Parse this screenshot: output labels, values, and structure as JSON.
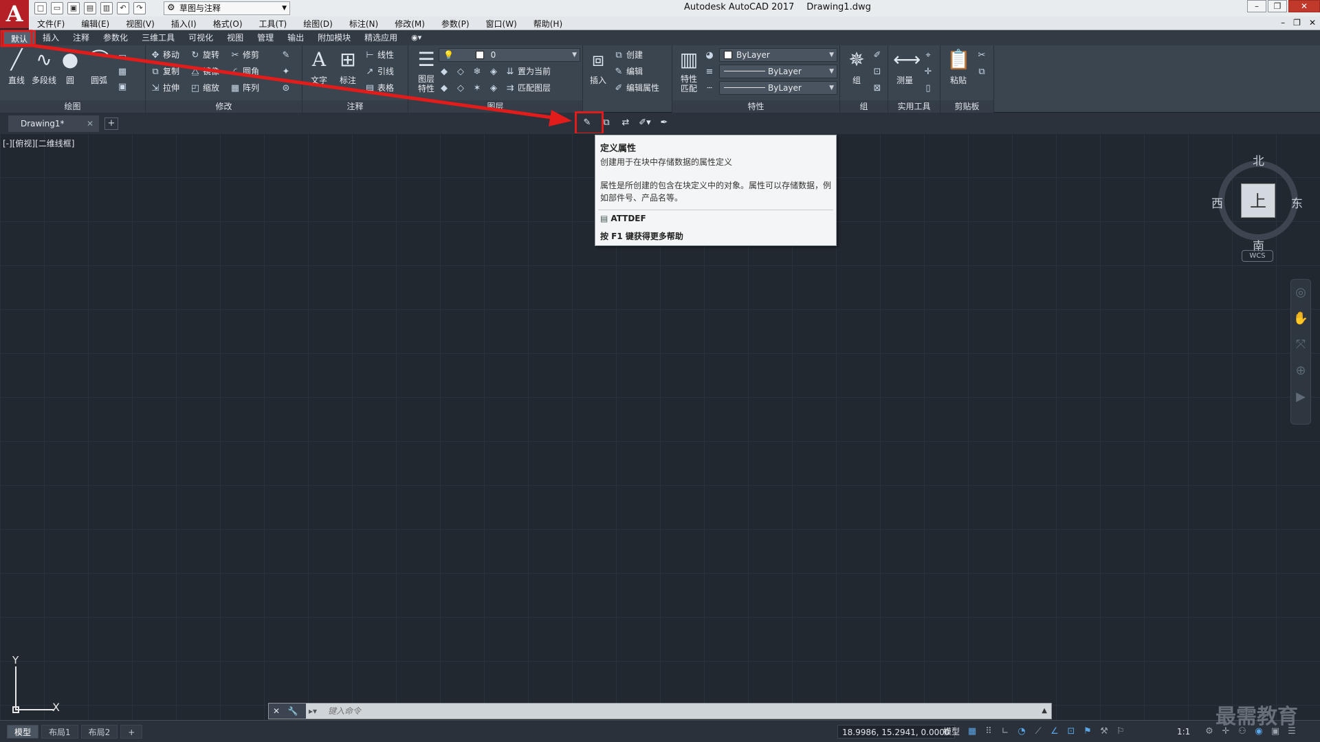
{
  "app": {
    "logo": "A",
    "title": "Autodesk AutoCAD 2017",
    "file": "Drawing1.dwg",
    "workspace": "草图与注释"
  },
  "menu": [
    "文件(F)",
    "编辑(E)",
    "视图(V)",
    "插入(I)",
    "格式(O)",
    "工具(T)",
    "绘图(D)",
    "标注(N)",
    "修改(M)",
    "参数(P)",
    "窗口(W)",
    "帮助(H)"
  ],
  "ribbon_tabs": [
    "默认",
    "插入",
    "注释",
    "参数化",
    "三维工具",
    "可视化",
    "视图",
    "管理",
    "输出",
    "附加模块",
    "精选应用"
  ],
  "ribbon": {
    "draw": {
      "title": "绘图",
      "line": "直线",
      "polyline": "多段线",
      "circle": "圆",
      "arc": "圆弧"
    },
    "modify": {
      "title": "修改",
      "move": "移动",
      "rotate": "旋转",
      "trim": "修剪",
      "copy": "复制",
      "mirror": "镜像",
      "fillet": "圆角",
      "stretch": "拉伸",
      "scale": "缩放",
      "array": "阵列"
    },
    "annotation": {
      "title": "注释",
      "text": "文字",
      "dimension": "标注",
      "linear": "线性",
      "leader": "引线",
      "table": "表格"
    },
    "layers": {
      "title": "图层",
      "layer_props": "图层\n特性",
      "layer_name": "0",
      "make_current": "置为当前",
      "match_layer": "匹配图层"
    },
    "block": {
      "insert": "插入",
      "create": "创建",
      "edit": "编辑",
      "edit_attributes": "编辑属性"
    },
    "properties": {
      "title": "特性",
      "match": "特性\n匹配",
      "color": "ByLayer",
      "linetype": "ByLayer",
      "lineweight": "ByLayer"
    },
    "groups": {
      "title": "组",
      "group": "组"
    },
    "utilities": {
      "title": "实用工具",
      "measure": "测量"
    },
    "clipboard": {
      "title": "剪贴板",
      "paste": "粘贴"
    }
  },
  "doc_tab": {
    "name": "Drawing1*"
  },
  "viewport_label": "[-][俯视][二维线框]",
  "viewcube": {
    "north": "北",
    "south": "南",
    "east": "东",
    "west": "西",
    "top": "上",
    "wcs": "WCS"
  },
  "ucs": {
    "x": "X",
    "y": "Y"
  },
  "tooltip": {
    "title": "定义属性",
    "description": "创建用于在块中存储数据的属性定义",
    "detail": "属性是所创建的包含在块定义中的对象。属性可以存储数据，例如部件号、产品名等。",
    "command": "ATTDEF",
    "help": "按 F1 键获得更多帮助"
  },
  "command_line": {
    "placeholder": "键入命令"
  },
  "layout_tabs": [
    "模型",
    "布局1",
    "布局2"
  ],
  "status": {
    "coords": "18.9986, 15.2941, 0.0000",
    "model": "模型",
    "scale": "1:1"
  },
  "watermark": "最需教育",
  "colors": {
    "highlight": "#e21b1b",
    "canvas": "#212830",
    "accent": "#5aa6e8"
  }
}
